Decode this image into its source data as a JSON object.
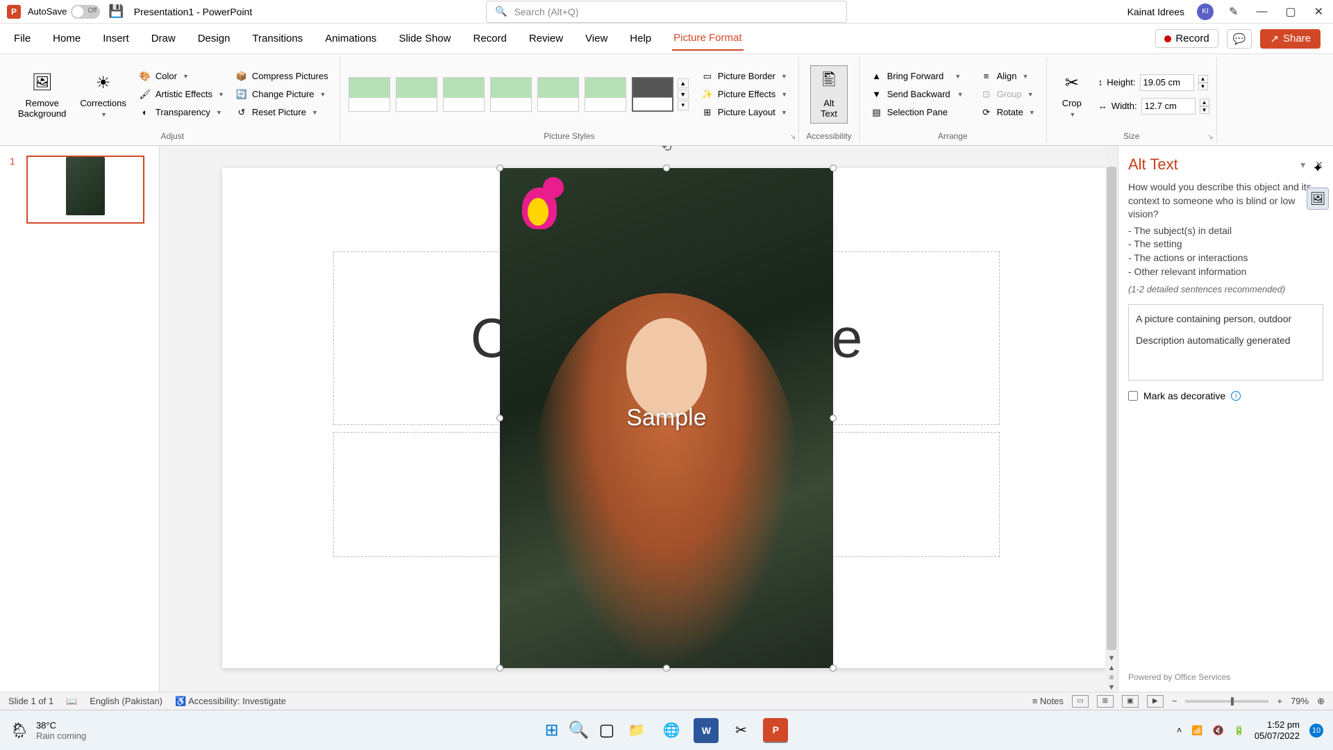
{
  "title_bar": {
    "autosave_label": "AutoSave",
    "autosave_state": "Off",
    "doc_title": "Presentation1  -  PowerPoint",
    "search_placeholder": "Search (Alt+Q)",
    "user_name": "Kainat Idrees",
    "user_initials": "KI"
  },
  "menu": {
    "items": [
      "File",
      "Home",
      "Insert",
      "Draw",
      "Design",
      "Transitions",
      "Animations",
      "Slide Show",
      "Record",
      "Review",
      "View",
      "Help",
      "Picture Format"
    ],
    "active_index": 12,
    "record_label": "Record",
    "share_label": "Share"
  },
  "ribbon": {
    "remove_bg": "Remove\nBackground",
    "corrections": "Corrections",
    "color": "Color",
    "artistic": "Artistic Effects",
    "transparency": "Transparency",
    "compress": "Compress Pictures",
    "change_pic": "Change Picture",
    "reset_pic": "Reset Picture",
    "adjust_label": "Adjust",
    "styles_label": "Picture Styles",
    "pic_border": "Picture Border",
    "pic_effects": "Picture Effects",
    "pic_layout": "Picture Layout",
    "alt_text": "Alt\nText",
    "accessibility_label": "Accessibility",
    "bring_forward": "Bring Forward",
    "send_backward": "Send Backward",
    "selection_pane": "Selection Pane",
    "align": "Align",
    "group": "Group",
    "rotate": "Rotate",
    "arrange_label": "Arrange",
    "crop": "Crop",
    "height_label": "Height:",
    "height_value": "19.05 cm",
    "width_label": "Width:",
    "width_value": "12.7 cm",
    "size_label": "Size"
  },
  "slides": {
    "thumb_number": "1"
  },
  "canvas": {
    "title_placeholder_hint": "Click to add title",
    "title_visible_left": "C",
    "title_visible_right": "e",
    "sample_watermark": "Sample"
  },
  "alt_pane": {
    "title": "Alt Text",
    "desc": "How would you describe this object and its context to someone who is blind or low vision?",
    "bullet1": "- The subject(s) in detail",
    "bullet2": "- The setting",
    "bullet3": "- The actions or interactions",
    "bullet4": "- Other relevant information",
    "hint": "(1-2 detailed sentences recommended)",
    "text_line1": "A picture containing person, outdoor",
    "text_line2": "Description automatically generated",
    "mark_decorative": "Mark as decorative",
    "powered": "Powered by Office Services"
  },
  "status": {
    "slide_info": "Slide 1 of 1",
    "language": "English (Pakistan)",
    "accessibility": "Accessibility: Investigate",
    "notes": "Notes",
    "zoom": "79%"
  },
  "taskbar": {
    "temp": "38°C",
    "weather": "Rain coming",
    "time": "1:52 pm",
    "date": "05/07/2022",
    "badge": "10"
  }
}
